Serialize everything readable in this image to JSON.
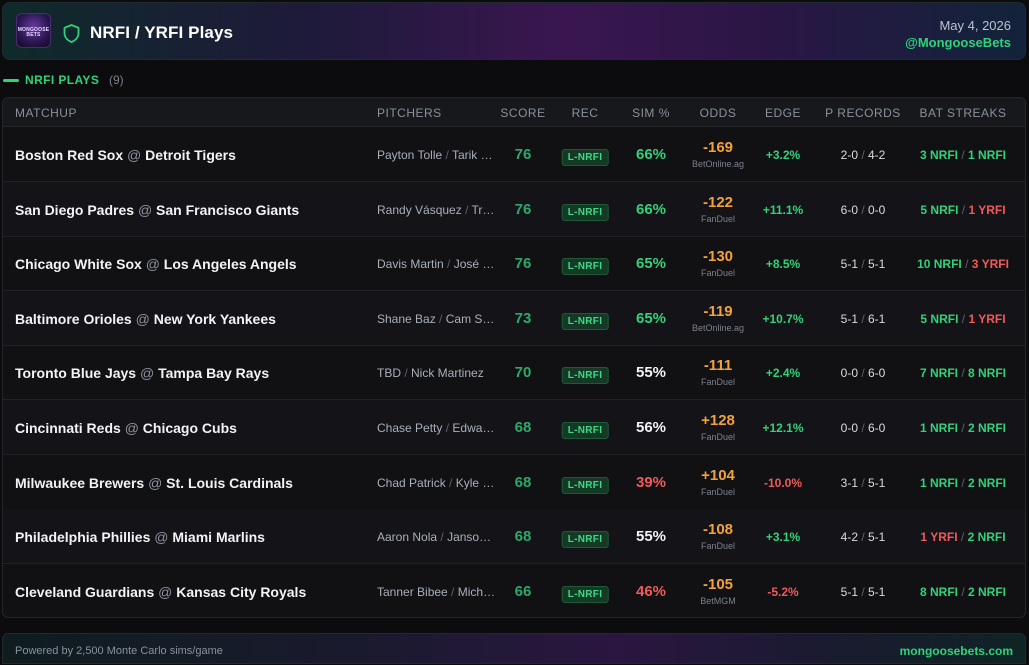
{
  "header": {
    "logo_text": "MONGOOSE BETS",
    "title": "NRFI / YRFI Plays",
    "date": "May 4, 2026",
    "handle": "@MongooseBets"
  },
  "section": {
    "title": "NRFI PLAYS",
    "count": "(9)"
  },
  "columns": {
    "matchup": "MATCHUP",
    "pitchers": "PITCHERS",
    "score": "SCORE",
    "rec": "REC",
    "sim": "SIM %",
    "odds": "ODDS",
    "edge": "EDGE",
    "p_records": "P RECORDS",
    "bat_streaks": "BAT STREAKS"
  },
  "colors": {
    "accent_green": "#2ed37a",
    "negative_red": "#f05a5a",
    "odds_orange": "#f2a23a",
    "score_green": "#2ea86a"
  },
  "rows": [
    {
      "away": "Boston Red Sox",
      "at": "@",
      "home": "Detroit Tigers",
      "p1": "Payton Tolle",
      "p2": "Tarik Skubal",
      "score": "76",
      "rec": "L-NRFI",
      "sim": "66%",
      "sim_color": "green",
      "odds": "-169",
      "book": "BetOnline.ag",
      "edge": "+3.2%",
      "edge_color": "green",
      "pr1": "2-0",
      "pr2": "4-2",
      "bat1": "3 NRFI",
      "bat1_color": "green",
      "bat2": "1 NRFI",
      "bat2_color": "green"
    },
    {
      "away": "San Diego Padres",
      "at": "@",
      "home": "San Francisco Giants",
      "p1": "Randy Vásquez",
      "p2": "Trevor McDonald",
      "score": "76",
      "rec": "L-NRFI",
      "sim": "66%",
      "sim_color": "green",
      "odds": "-122",
      "book": "FanDuel",
      "edge": "+11.1%",
      "edge_color": "green",
      "pr1": "6-0",
      "pr2": "0-0",
      "bat1": "5 NRFI",
      "bat1_color": "green",
      "bat2": "1 YRFI",
      "bat2_color": "red"
    },
    {
      "away": "Chicago White Sox",
      "at": "@",
      "home": "Los Angeles Angels",
      "p1": "Davis Martin",
      "p2": "José Soriano",
      "score": "76",
      "rec": "L-NRFI",
      "sim": "65%",
      "sim_color": "green",
      "odds": "-130",
      "book": "FanDuel",
      "edge": "+8.5%",
      "edge_color": "green",
      "pr1": "5-1",
      "pr2": "5-1",
      "bat1": "10 NRFI",
      "bat1_color": "green",
      "bat2": "3 YRFI",
      "bat2_color": "red"
    },
    {
      "away": "Baltimore Orioles",
      "at": "@",
      "home": "New York Yankees",
      "p1": "Shane Baz",
      "p2": "Cam Schlittler",
      "score": "73",
      "rec": "L-NRFI",
      "sim": "65%",
      "sim_color": "green",
      "odds": "-119",
      "book": "BetOnline.ag",
      "edge": "+10.7%",
      "edge_color": "green",
      "pr1": "5-1",
      "pr2": "6-1",
      "bat1": "5 NRFI",
      "bat1_color": "green",
      "bat2": "1 YRFI",
      "bat2_color": "red"
    },
    {
      "away": "Toronto Blue Jays",
      "at": "@",
      "home": "Tampa Bay Rays",
      "p1": "TBD",
      "p2": "Nick Martinez",
      "score": "70",
      "rec": "L-NRFI",
      "sim": "55%",
      "sim_color": "white",
      "odds": "-111",
      "book": "FanDuel",
      "edge": "+2.4%",
      "edge_color": "green",
      "pr1": "0-0",
      "pr2": "6-0",
      "bat1": "7 NRFI",
      "bat1_color": "green",
      "bat2": "8 NRFI",
      "bat2_color": "green"
    },
    {
      "away": "Cincinnati Reds",
      "at": "@",
      "home": "Chicago Cubs",
      "p1": "Chase Petty",
      "p2": "Edward Cabrera",
      "score": "68",
      "rec": "L-NRFI",
      "sim": "56%",
      "sim_color": "white",
      "odds": "+128",
      "book": "FanDuel",
      "edge": "+12.1%",
      "edge_color": "green",
      "pr1": "0-0",
      "pr2": "6-0",
      "bat1": "1 NRFI",
      "bat1_color": "green",
      "bat2": "2 NRFI",
      "bat2_color": "green"
    },
    {
      "away": "Milwaukee Brewers",
      "at": "@",
      "home": "St. Louis Cardinals",
      "p1": "Chad Patrick",
      "p2": "Kyle Leahy",
      "score": "68",
      "rec": "L-NRFI",
      "sim": "39%",
      "sim_color": "red",
      "odds": "+104",
      "book": "FanDuel",
      "edge": "-10.0%",
      "edge_color": "red",
      "pr1": "3-1",
      "pr2": "5-1",
      "bat1": "1 NRFI",
      "bat1_color": "green",
      "bat2": "2 NRFI",
      "bat2_color": "green"
    },
    {
      "away": "Philadelphia Phillies",
      "at": "@",
      "home": "Miami Marlins",
      "p1": "Aaron Nola",
      "p2": "Janson Junk",
      "score": "68",
      "rec": "L-NRFI",
      "sim": "55%",
      "sim_color": "white",
      "odds": "-108",
      "book": "FanDuel",
      "edge": "+3.1%",
      "edge_color": "green",
      "pr1": "4-2",
      "pr2": "5-1",
      "bat1": "1 YRFI",
      "bat1_color": "red",
      "bat2": "2 NRFI",
      "bat2_color": "green"
    },
    {
      "away": "Cleveland Guardians",
      "at": "@",
      "home": "Kansas City Royals",
      "p1": "Tanner Bibee",
      "p2": "Michael Wacha",
      "score": "66",
      "rec": "L-NRFI",
      "sim": "46%",
      "sim_color": "red",
      "odds": "-105",
      "book": "BetMGM",
      "edge": "-5.2%",
      "edge_color": "red",
      "pr1": "5-1",
      "pr2": "5-1",
      "bat1": "8 NRFI",
      "bat1_color": "green",
      "bat2": "2 NRFI",
      "bat2_color": "green"
    }
  ],
  "footer": {
    "left": "Powered by 2,500 Monte Carlo sims/game",
    "right": "mongoosebets.com"
  }
}
